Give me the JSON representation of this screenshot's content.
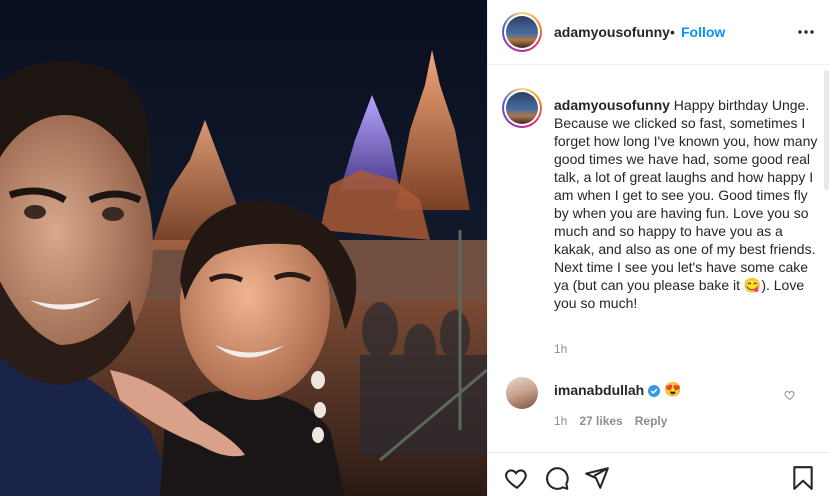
{
  "post": {
    "username": "adamyousofunny",
    "separator": "•",
    "follow_label": "Follow",
    "caption_text": "Happy birthday Unge. Because we clicked so fast, sometimes I forget how long I've known you, how many good times we have had, some good real talk, a lot of great laughs and how happy I am when I get to see you. Good times fly by when you are having fun. Love you so much and so happy to have you as a kakak, and also as one of my best friends. Next time I see you let's have some cake ya (but can you please bake it 😋). Love you so much!",
    "caption_time": "1h"
  },
  "comment": {
    "username": "imanabdullah",
    "text": "😍",
    "time": "1h",
    "likes": "27 likes",
    "reply_label": "Reply"
  },
  "icons": {
    "more": "more-options-icon",
    "like": "heart-icon",
    "comment": "comment-icon",
    "share": "share-icon",
    "save": "bookmark-icon",
    "verified": "verified-badge-icon"
  },
  "colors": {
    "link_blue": "#0095f6",
    "verified_blue": "#3897f0",
    "text": "#262626",
    "muted": "#8e8e8e"
  }
}
